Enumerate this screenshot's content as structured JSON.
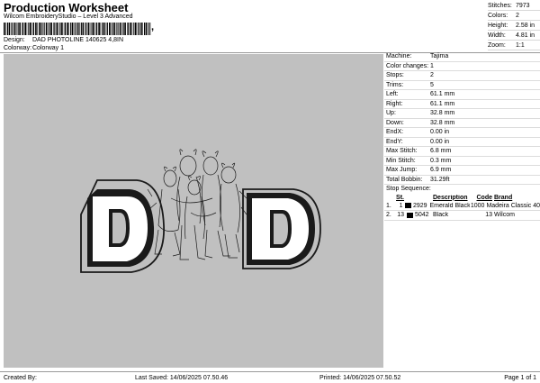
{
  "header": {
    "title": "Production Worksheet",
    "subtitle": "Wilcom EmbroideryStudio – Level 3 Advanced",
    "barcode_suffix": ",",
    "design_label": "Design:",
    "design_value": "DAD PHOTOLINE 140625 4,8IN",
    "colorway_label": "Colorway:",
    "colorway_value": "Colorway 1"
  },
  "stats": [
    {
      "label": "Stitches:",
      "value": "7973"
    },
    {
      "label": "Colors:",
      "value": "2"
    },
    {
      "label": "Height:",
      "value": "2.58 in"
    },
    {
      "label": "Width:",
      "value": "4.81 in"
    },
    {
      "label": "Zoom:",
      "value": "1:1"
    }
  ],
  "machine_info": [
    {
      "label": "Machine:",
      "value": "Tajima"
    },
    {
      "label": "Color changes:",
      "value": "1"
    },
    {
      "label": "Stops:",
      "value": "2"
    },
    {
      "label": "Trims:",
      "value": "5"
    },
    {
      "label": "Left:",
      "value": "61.1 mm"
    },
    {
      "label": "Right:",
      "value": "61.1 mm"
    },
    {
      "label": "Up:",
      "value": "32.8 mm"
    },
    {
      "label": "Down:",
      "value": "32.8 mm"
    },
    {
      "label": "EndX:",
      "value": "0.00 in"
    },
    {
      "label": "EndY:",
      "value": "0.00 in"
    },
    {
      "label": "Max Stitch:",
      "value": "6.8 mm"
    },
    {
      "label": "Min Stitch:",
      "value": "0.3 mm"
    },
    {
      "label": "Max Jump:",
      "value": "6.9 mm"
    },
    {
      "label": "Total Bobbin:",
      "value": "31.29ft"
    }
  ],
  "stop_sequence": {
    "title": "Stop Sequence:",
    "headers": {
      "stitches": "St.",
      "description": "Description",
      "code": "Code",
      "brand": "Brand"
    },
    "rows": [
      {
        "num": "1.",
        "stitches": "1",
        "swatch": "#000000",
        "code": "2929",
        "description": "Emerald Black",
        "code2": "1000",
        "brand": "Madeira Classic 40"
      },
      {
        "num": "2.",
        "stitches": "13",
        "swatch": "#000000",
        "code": "5042",
        "description": "Black",
        "code2": "13",
        "brand": "Wilcom"
      }
    ]
  },
  "footer": {
    "created_by": "Created By:",
    "last_saved": "Last Saved: 14/06/2025 07.50.46",
    "printed": "Printed: 14/06/2025 07.50.52",
    "page": "Page 1 of 1"
  },
  "colors": {
    "canvas": "#c0c0c0",
    "stitch": "#1a1a1a"
  }
}
